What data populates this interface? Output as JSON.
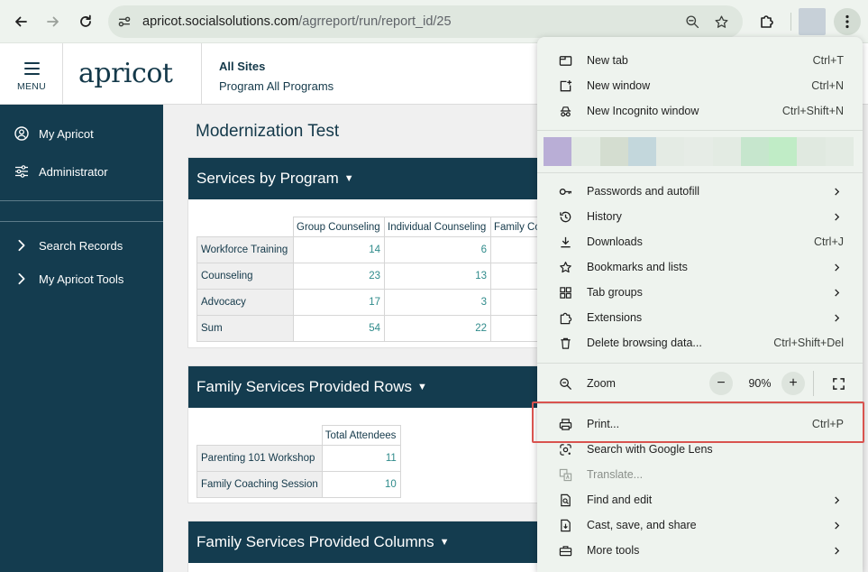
{
  "browser": {
    "url_host": "apricot.socialsolutions.com",
    "url_path": "/agrreport/run/report_id/25"
  },
  "header": {
    "menu_label": "MENU",
    "logo": "apricot",
    "site": "All Sites",
    "program": "Program All Programs"
  },
  "sidebar": {
    "items": [
      {
        "label": "My Apricot",
        "icon": "user-circle-icon"
      },
      {
        "label": "Administrator",
        "icon": "sliders-icon"
      },
      {
        "label": "Search Records",
        "icon": "chevron-right-icon"
      },
      {
        "label": "My Apricot Tools",
        "icon": "chevron-right-icon"
      }
    ]
  },
  "main": {
    "title": "Modernization Test",
    "panels": [
      {
        "title": "Services by Program",
        "columns": [
          "Group Counseling",
          "Individual Counseling",
          "Family Co"
        ],
        "rows": [
          {
            "label": "Workforce Training",
            "values": [
              "14",
              "6"
            ]
          },
          {
            "label": "Counseling",
            "values": [
              "23",
              "13"
            ]
          },
          {
            "label": "Advocacy",
            "values": [
              "17",
              "3"
            ]
          },
          {
            "label": "Sum",
            "values": [
              "54",
              "22"
            ]
          }
        ]
      },
      {
        "title": "Family Services Provided Rows",
        "columns": [
          "Total Attendees"
        ],
        "rows": [
          {
            "label": "Parenting 101 Workshop",
            "values": [
              "11"
            ]
          },
          {
            "label": "Family Coaching Session",
            "values": [
              "10"
            ]
          }
        ]
      },
      {
        "title": "Family Services Provided Columns"
      }
    ]
  },
  "chrome_menu": {
    "new_tab": {
      "label": "New tab",
      "shortcut": "Ctrl+T"
    },
    "new_window": {
      "label": "New window",
      "shortcut": "Ctrl+N"
    },
    "incognito": {
      "label": "New Incognito window",
      "shortcut": "Ctrl+Shift+N"
    },
    "profile_swatch_colors": [
      "#b9aed6",
      "#e3ebe3",
      "#d4ddd0",
      "#c3d7dc",
      "#e4ebe4",
      "#e6ece6",
      "#e3ebe3",
      "#c6e6cd",
      "#c0ecc6",
      "#e0e9e0",
      "#e3ebe3"
    ],
    "passwords": {
      "label": "Passwords and autofill"
    },
    "history": {
      "label": "History"
    },
    "downloads": {
      "label": "Downloads",
      "shortcut": "Ctrl+J"
    },
    "bookmarks": {
      "label": "Bookmarks and lists"
    },
    "tab_groups": {
      "label": "Tab groups"
    },
    "extensions": {
      "label": "Extensions"
    },
    "delete_data": {
      "label": "Delete browsing data...",
      "shortcut": "Ctrl+Shift+Del"
    },
    "zoom": {
      "label": "Zoom",
      "minus": "−",
      "value": "90%",
      "plus": "+"
    },
    "print": {
      "label": "Print...",
      "shortcut": "Ctrl+P"
    },
    "lens": {
      "label": "Search with Google Lens"
    },
    "translate": {
      "label": "Translate..."
    },
    "find_edit": {
      "label": "Find and edit"
    },
    "cast": {
      "label": "Cast, save, and share"
    },
    "more_tools": {
      "label": "More tools"
    }
  },
  "colors": {
    "brand_navy": "#143c4f",
    "highlight": "#d9534f",
    "link_teal": "#2f8b8b"
  }
}
